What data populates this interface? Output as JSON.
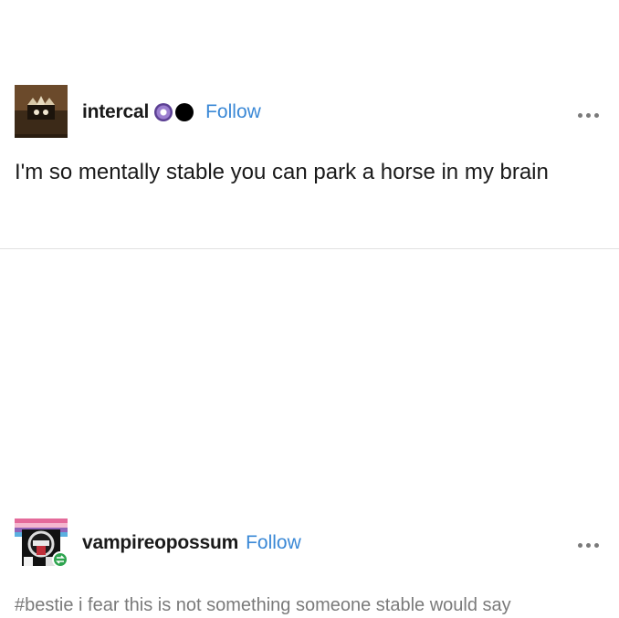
{
  "posts": [
    {
      "username": "intercal",
      "follow_label": "Follow",
      "text": "I'm so mentally stable you can park a horse in my brain",
      "badges": [
        {
          "icon": "purple-sparkle-badge-icon",
          "color": "#8a6fbf"
        },
        {
          "icon": "black-circle-badge-icon",
          "color": "#000000"
        }
      ],
      "more_icon": "more-options-icon"
    },
    {
      "username": "vampireopossum",
      "follow_label": "Follow",
      "tags": "#bestie i fear this is not something someone stable would say",
      "reblog_icon": "reblog-icon",
      "more_icon": "more-options-icon"
    }
  ],
  "colors": {
    "follow": "#3a88d6",
    "text": "#1a1a1a",
    "tags": "#7a7a7a",
    "reblog_badge": "#2ea44f"
  }
}
